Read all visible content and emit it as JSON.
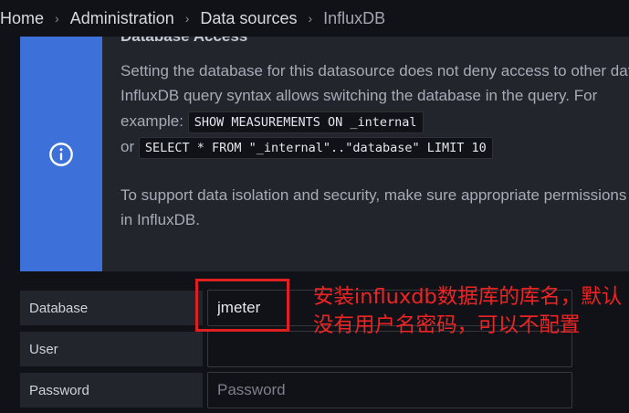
{
  "breadcrumb": {
    "items": [
      "Home",
      "Administration",
      "Data sources",
      "InfluxDB"
    ]
  },
  "info": {
    "title": "Database Access",
    "line1": "Setting the database for this datasource does not deny access to other databases.",
    "line2": "InfluxDB query syntax allows switching the database in the query. For",
    "example_label": "example:",
    "code1": "SHOW MEASUREMENTS ON _internal",
    "or_label": "or",
    "code2": "SELECT * FROM \"_internal\"..\"database\" LIMIT 10",
    "line3": "To support data isolation and security, make sure appropriate permissions are configured",
    "line4": "in InfluxDB.",
    "icon": "info-circle-icon",
    "accent_color": "#3d71d9"
  },
  "form": {
    "database": {
      "label": "Database",
      "value": "jmeter"
    },
    "user": {
      "label": "User",
      "value": ""
    },
    "password": {
      "label": "Password",
      "placeholder": "Password"
    }
  },
  "annotation": {
    "text": "安装influxdb数据库的库名，默认没有用户名密码，可以不配置",
    "color": "#ee2424"
  }
}
